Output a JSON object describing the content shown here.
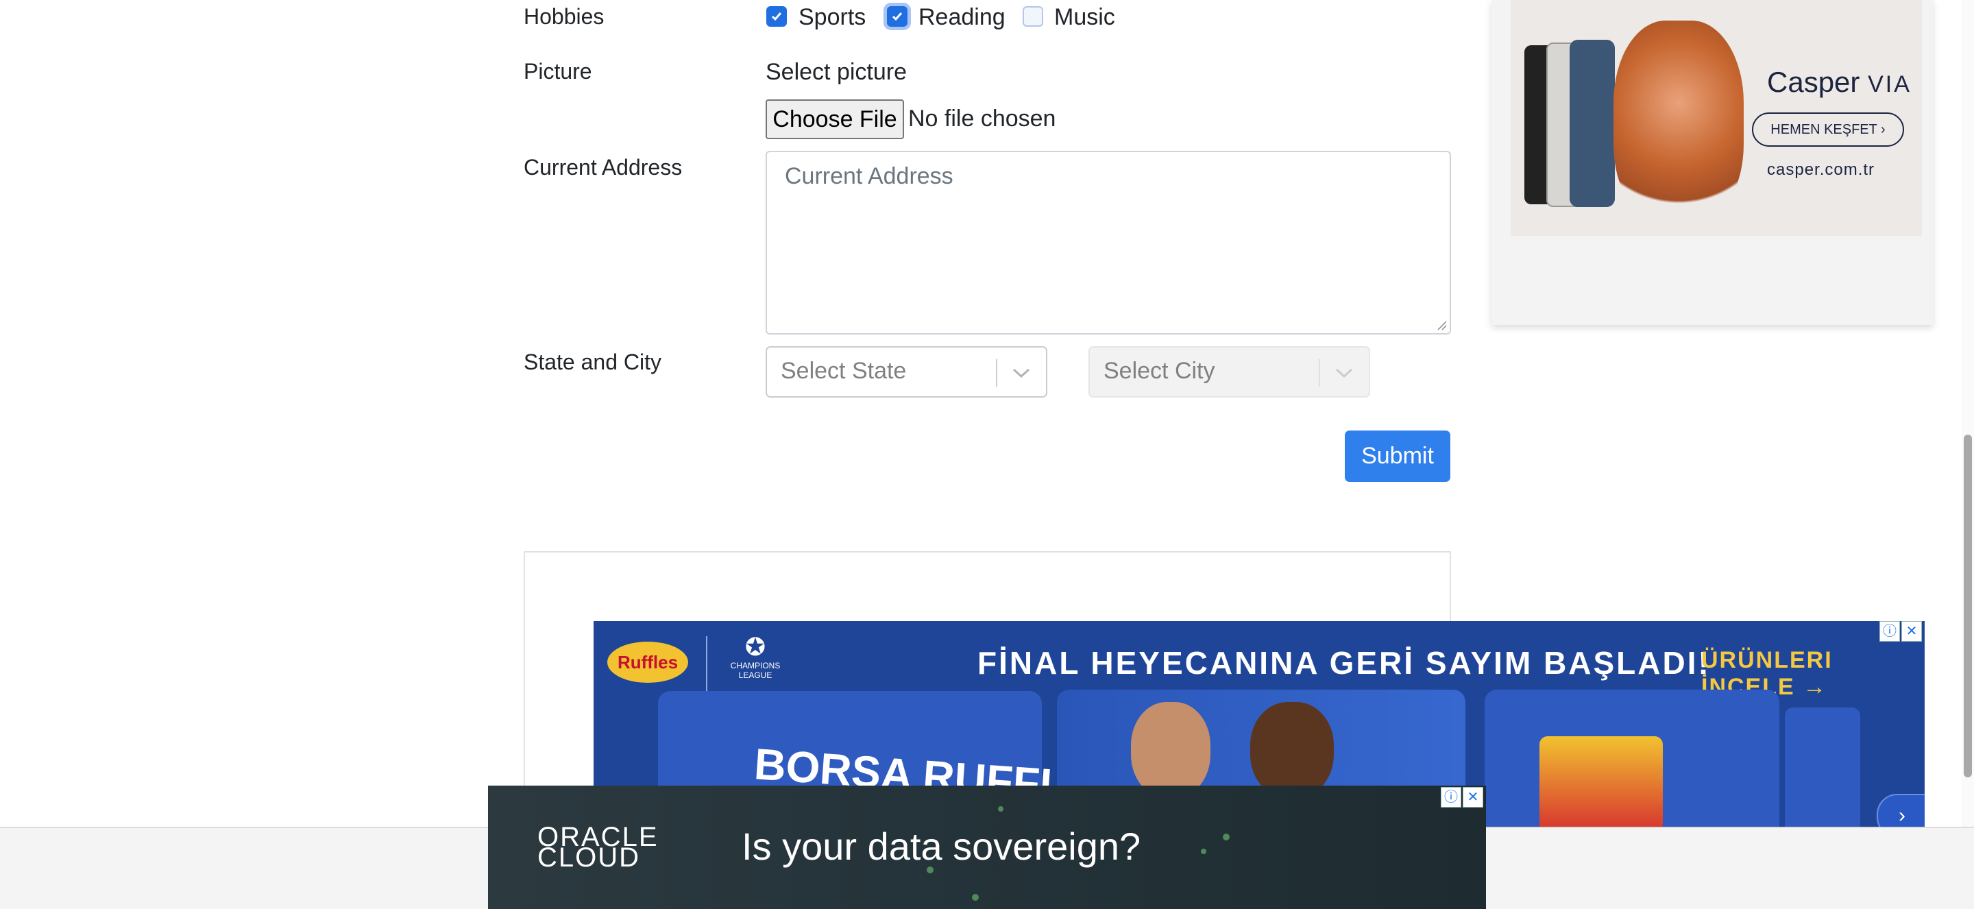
{
  "form": {
    "hobbies": {
      "label": "Hobbies",
      "options": [
        {
          "label": "Sports",
          "checked": true
        },
        {
          "label": "Reading",
          "checked": true
        },
        {
          "label": "Music",
          "checked": false
        }
      ]
    },
    "picture": {
      "label": "Picture",
      "sub_label": "Select picture",
      "button_label": "Choose File",
      "status_text": "No file chosen"
    },
    "address": {
      "label": "Current Address",
      "placeholder": "Current Address"
    },
    "state_city": {
      "label": "State and City",
      "state_placeholder": "Select State",
      "city_placeholder": "Select City"
    },
    "submit_label": "Submit"
  },
  "ads": {
    "side": {
      "brand": "Casper",
      "brand_sub": "VIA",
      "cta": "HEMEN KEŞFET",
      "url": "casper.com.tr"
    },
    "banner": {
      "brand": "Ruffles",
      "league": "CHAMPIONS LEAGUE",
      "headline": "FİNAL HEYECANINA GERİ SAYIM BAŞLADI!",
      "cta": "ÜRÜNLERI İNCELE",
      "card_text": "BORSA RUFFLES"
    },
    "oracle": {
      "logo_line1": "ORACLE",
      "logo_line2": "CLOUD",
      "text": "Is your data sovereign?"
    }
  },
  "colors": {
    "primary": "#2f80ed",
    "checked": "#1f6fe0",
    "banner_bg": "#1f4599",
    "oracle_bg": "#25343a"
  }
}
